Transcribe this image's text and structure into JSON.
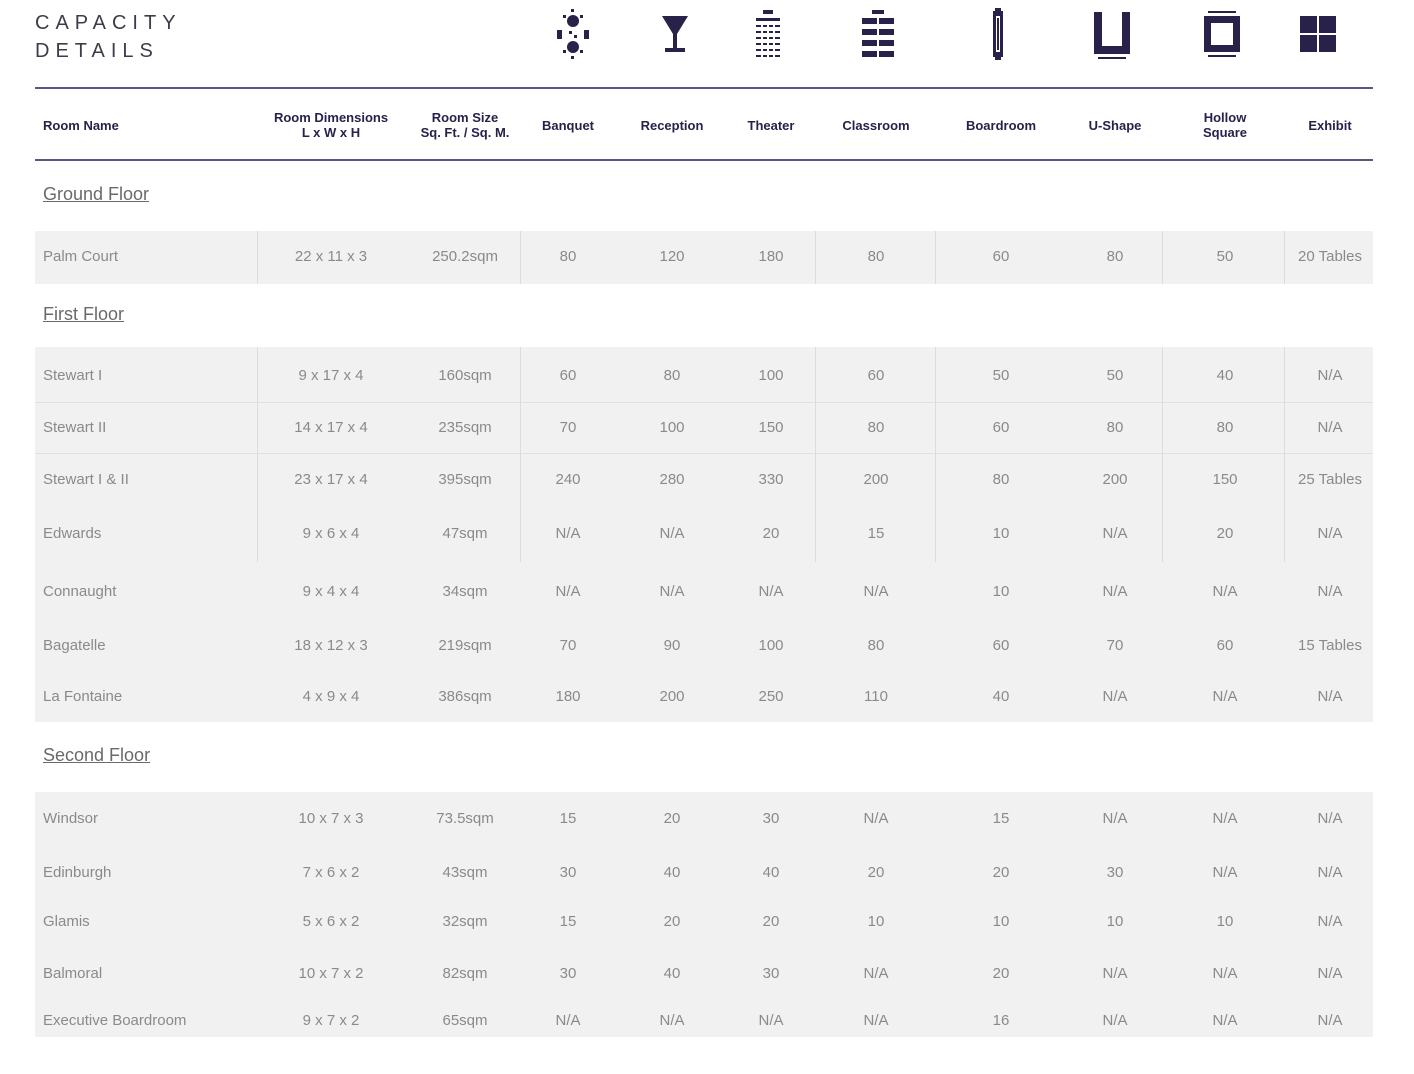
{
  "title": {
    "line1": "CAPACITY",
    "line2": "DETAILS"
  },
  "colors": {
    "accent": "#28224a",
    "rule": "#5b5585",
    "band": "#f1f1f1"
  },
  "icons": [
    "banquet-icon",
    "reception-icon",
    "theater-icon",
    "classroom-icon",
    "boardroom-icon",
    "u-shape-icon",
    "hollow-square-icon",
    "exhibit-icon"
  ],
  "headers": [
    "Room Name",
    "Room Dimensions\nL x W x H",
    "Room Size\nSq. Ft. / Sq. M.",
    "Banquet",
    "Reception",
    "Theater",
    "Classroom",
    "Boardroom",
    "U-Shape",
    "Hollow\nSquare",
    "Exhibit"
  ],
  "floors": [
    {
      "label": "Ground Floor",
      "rows": [
        [
          "Palm Court",
          "22 x 11 x 3",
          "250.2sqm",
          "80",
          "120",
          "180",
          "80",
          "60",
          "80",
          "50",
          "20 Tables"
        ]
      ]
    },
    {
      "label": "First Floor",
      "rows": [
        [
          "Stewart I",
          "9 x 17 x 4",
          "160sqm",
          "60",
          "80",
          "100",
          "60",
          "50",
          "50",
          "40",
          "N/A"
        ],
        [
          "Stewart II",
          "14 x 17 x 4",
          "235sqm",
          "70",
          "100",
          "150",
          "80",
          "60",
          "80",
          "80",
          "N/A"
        ],
        [
          "Stewart I & II",
          "23 x 17 x 4",
          "395sqm",
          "240",
          "280",
          "330",
          "200",
          "80",
          "200",
          "150",
          "25 Tables"
        ],
        [
          "Edwards",
          "9 x 6 x 4",
          "47sqm",
          "N/A",
          "N/A",
          "20",
          "15",
          "10",
          "N/A",
          "20",
          "N/A"
        ],
        [
          "Connaught",
          "9 x 4 x 4",
          "34sqm",
          "N/A",
          "N/A",
          "N/A",
          "N/A",
          "10",
          "N/A",
          "N/A",
          "N/A"
        ],
        [
          "Bagatelle",
          "18 x 12 x 3",
          "219sqm",
          "70",
          "90",
          "100",
          "80",
          "60",
          "70",
          "60",
          "15 Tables"
        ],
        [
          "La Fontaine",
          "4 x 9 x 4",
          "386sqm",
          "180",
          "200",
          "250",
          "110",
          "40",
          "N/A",
          "N/A",
          "N/A"
        ]
      ]
    },
    {
      "label": "Second Floor",
      "rows": [
        [
          "Windsor",
          "10 x 7 x 3",
          "73.5sqm",
          "15",
          "20",
          "30",
          "N/A",
          "15",
          "N/A",
          "N/A",
          "N/A"
        ],
        [
          "Edinburgh",
          "7 x 6 x 2",
          "43sqm",
          "30",
          "40",
          "40",
          "20",
          "20",
          "30",
          "N/A",
          "N/A"
        ],
        [
          "Glamis",
          "5 x 6 x 2",
          "32sqm",
          "15",
          "20",
          "20",
          "10",
          "10",
          "10",
          "10",
          "N/A"
        ],
        [
          "Balmoral",
          "10 x 7 x 2",
          "82sqm",
          "30",
          "40",
          "30",
          "N/A",
          "20",
          "N/A",
          "N/A",
          "N/A"
        ],
        [
          "Executive Boardroom",
          "9 x 7 x 2",
          "65sqm",
          "N/A",
          "N/A",
          "N/A",
          "N/A",
          "16",
          "N/A",
          "N/A",
          "N/A"
        ]
      ]
    }
  ]
}
